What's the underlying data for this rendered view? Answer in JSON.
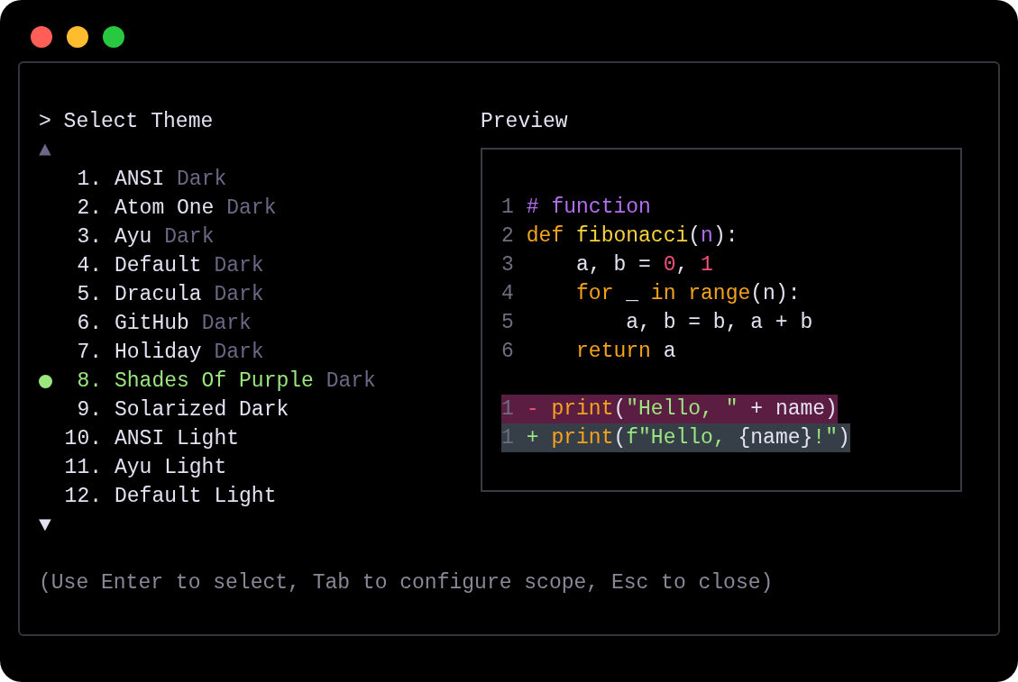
{
  "window_controls": [
    {
      "color": "#ff5f57"
    },
    {
      "color": "#febc2e"
    },
    {
      "color": "#28c840"
    }
  ],
  "theme_picker": {
    "prompt": ">",
    "title": "Select Theme",
    "scroll_up": {
      "glyph": "▲",
      "active": false
    },
    "themes": [
      {
        "number": "1.",
        "name": "ANSI",
        "variant": "Dark",
        "selected": false
      },
      {
        "number": "2.",
        "name": "Atom One",
        "variant": "Dark",
        "selected": false
      },
      {
        "number": "3.",
        "name": "Ayu",
        "variant": "Dark",
        "selected": false
      },
      {
        "number": "4.",
        "name": "Default",
        "variant": "Dark",
        "selected": false
      },
      {
        "number": "5.",
        "name": "Dracula",
        "variant": "Dark",
        "selected": false
      },
      {
        "number": "6.",
        "name": "GitHub",
        "variant": "Dark",
        "selected": false
      },
      {
        "number": "7.",
        "name": "Holiday",
        "variant": "Dark",
        "selected": false
      },
      {
        "number": "8.",
        "name": "Shades Of Purple",
        "variant": "Dark",
        "selected": true
      },
      {
        "number": "9.",
        "name": "Solarized Dark",
        "selected": false
      },
      {
        "number": "10.",
        "name": "ANSI Light",
        "selected": false
      },
      {
        "number": "11.",
        "name": "Ayu Light",
        "selected": false
      },
      {
        "number": "12.",
        "name": "Default Light",
        "selected": false
      }
    ],
    "scroll_down": {
      "glyph": "▼",
      "active": true
    }
  },
  "preview": {
    "title": "Preview",
    "code_lines": [
      {
        "number": "1",
        "tokens": [
          {
            "kind": "comment",
            "text": "# function"
          }
        ]
      },
      {
        "number": "2",
        "tokens": [
          {
            "kind": "keyword",
            "text": "def "
          },
          {
            "kind": "function",
            "text": "fibonacci"
          },
          {
            "kind": "plain",
            "text": "("
          },
          {
            "kind": "param",
            "text": "n"
          },
          {
            "kind": "plain",
            "text": "):"
          }
        ]
      },
      {
        "number": "3",
        "tokens": [
          {
            "kind": "plain",
            "text": "    a, b = "
          },
          {
            "kind": "number",
            "text": "0"
          },
          {
            "kind": "plain",
            "text": ", "
          },
          {
            "kind": "number",
            "text": "1"
          }
        ]
      },
      {
        "number": "4",
        "tokens": [
          {
            "kind": "keyword",
            "text": "    for"
          },
          {
            "kind": "plain",
            "text": " _ "
          },
          {
            "kind": "keyword",
            "text": "in range"
          },
          {
            "kind": "plain",
            "text": "(n):"
          }
        ]
      },
      {
        "number": "5",
        "tokens": [
          {
            "kind": "plain",
            "text": "        a, b = b, a + b"
          }
        ]
      },
      {
        "number": "6",
        "tokens": [
          {
            "kind": "keyword",
            "text": "    return"
          },
          {
            "kind": "plain",
            "text": " a"
          }
        ]
      }
    ],
    "diff_lines": [
      {
        "kind": "removed",
        "number": "1",
        "sign": "-",
        "tokens": [
          {
            "kind": "keyword",
            "text": "print"
          },
          {
            "kind": "plain",
            "text": "("
          },
          {
            "kind": "string",
            "text": "\"Hello, \""
          },
          {
            "kind": "plain",
            "text": " + name)"
          }
        ]
      },
      {
        "kind": "added",
        "number": "1",
        "sign": "+",
        "tokens": [
          {
            "kind": "keyword",
            "text": "print"
          },
          {
            "kind": "plain",
            "text": "("
          },
          {
            "kind": "string",
            "text": "f\"Hello, "
          },
          {
            "kind": "plain",
            "text": "{name}"
          },
          {
            "kind": "string",
            "text": "!\""
          },
          {
            "kind": "plain",
            "text": ")"
          }
        ]
      }
    ]
  },
  "hint": "(Use Enter to select, Tab to configure scope, Esc to close)"
}
